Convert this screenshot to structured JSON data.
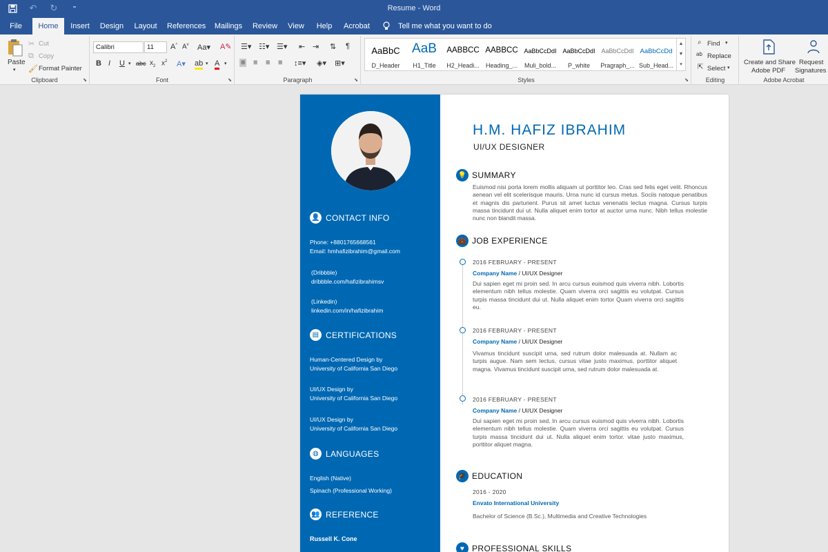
{
  "app": {
    "title": "Resume - Word"
  },
  "tabs": [
    {
      "label": "File"
    },
    {
      "label": "Home"
    },
    {
      "label": "Insert"
    },
    {
      "label": "Design"
    },
    {
      "label": "Layout"
    },
    {
      "label": "References"
    },
    {
      "label": "Mailings"
    },
    {
      "label": "Review"
    },
    {
      "label": "View"
    },
    {
      "label": "Help"
    },
    {
      "label": "Acrobat"
    }
  ],
  "tellme": "Tell me what you want to do",
  "ribbon": {
    "clipboard": {
      "paste": "Paste",
      "cut": "Cut",
      "copy": "Copy",
      "format_painter": "Format Painter",
      "label": "Clipboard"
    },
    "font": {
      "name": "Calibri",
      "size": "11",
      "label": "Font"
    },
    "paragraph": {
      "label": "Paragraph"
    },
    "styles": {
      "label": "Styles",
      "items": [
        {
          "sample": "AaBbC",
          "name": "D_Header"
        },
        {
          "sample": "AaB",
          "name": "H1_Title"
        },
        {
          "sample": "AABBCC",
          "name": "H2_Headi..."
        },
        {
          "sample": "AABBCC",
          "name": "Heading_..."
        },
        {
          "sample": "AaBbCcDdI",
          "name": "Muli_bold..."
        },
        {
          "sample": "AaBbCcDdI",
          "name": "P_white"
        },
        {
          "sample": "AaBbCcDdI",
          "name": "Pragraph_..."
        },
        {
          "sample": "AaBbCcDd",
          "name": "Sub_Head..."
        }
      ]
    },
    "editing": {
      "find": "Find",
      "replace": "Replace",
      "select": "Select",
      "label": "Editing"
    },
    "acrobat": {
      "create": "Create and Share",
      "create2": "Adobe PDF",
      "request": "Request",
      "request2": "Signatures",
      "label": "Adobe Acrobat"
    }
  },
  "resume": {
    "name": "H.M. HAFIZ IBRAHIM",
    "role": "UI/UX DESIGNER",
    "contact": {
      "heading": "CONTACT INFO",
      "phone": "Phone:  +8801765668561",
      "email": "Email: hmhafizibrahim@gmail.com",
      "dribbble_label": "(Dribbble)",
      "dribbble": "dribbble.com/hafizibrahimsv",
      "linkedin_label": "(Linkedin)",
      "linkedin": "linkedin.com/in/hafizibrahim"
    },
    "certifications": {
      "heading": "CERTIFICATIONS",
      "items": [
        {
          "title": "Human-Centered  Design  by",
          "org": "University  of  California  San  Diego"
        },
        {
          "title": "UI/UX  Design  by",
          "org": "University  of  California  San  Diego"
        },
        {
          "title": "UI/UX  Design  by",
          "org": "University  of  California  San  Diego"
        }
      ]
    },
    "languages": {
      "heading": "LANGUAGES",
      "items": [
        "English  (Native)",
        "Spinach  (Professional  Working)"
      ]
    },
    "reference": {
      "heading": "REFERENCE",
      "name": "Russell  K.  Cone"
    },
    "summary": {
      "heading": "SUMMARY",
      "text": "Euismod nisi porta lorem mollis aliquam ut porttitor leo. Cras sed felis eget velit. Rhoncus aenean vel elit scelerisque mauris. Urna nunc id cursus metus. Sociis natoque penatibus et magnis dis parturient. Purus sit amet luctus venenatis lectus magna. Cursus turpis massa tincidunt dui ut. Nulla aliquet enim tortor at auctor urna nunc. Nibh tellus molestie nunc non blandit massa."
    },
    "experience": {
      "heading": "JOB EXPERIENCE",
      "items": [
        {
          "date": "2016 FEBRUARY - PRESENT",
          "company": "Company Name",
          "title": "UI/UX Designer",
          "text": "Dui sapien eget mi proin sed. In arcu cursus euismod quis viverra nibh. Lobortis elementum nibh tellus molestie. Quam viverra orci sagittis eu volutpat. Cursus turpis massa tincidunt dui ut. Nulla aliquet enim tortor Quam viverra orci sagittis eu."
        },
        {
          "date": "2016 FEBRUARY - PRESENT",
          "company": "Company Name",
          "title": "UI/UX Designer",
          "text": "Vivamus tincidunt suscipit urna, sed rutrum dolor malesuada at. Nullam ac turpis augue. Nam sem lectus, cursus vitae justo maximus, porttitor aliquet magna. Vivamus tincidunt suscipit urna, sed rutrum dolor malesuada at."
        },
        {
          "date": "2016 FEBRUARY - PRESENT",
          "company": "Company Name",
          "title": "UI/UX Designer",
          "text": "Dui sapien eget mi proin sed. In arcu cursus euismod quis viverra nibh. Lobortis elementum nibh tellus molestie. Quam viverra orci sagittis eu volutpat. Cursus turpis massa tincidunt dui ut. Nulla aliquet enim tortor. vitae justo maximus, porttitor aliquet magna."
        }
      ]
    },
    "education": {
      "heading": "EDUCATION",
      "date": "2016 - 2020",
      "school": "Envato  International  University",
      "degree": "Bachelor of Science (B.Sc.), Multimedia and Creative Technologies"
    },
    "skills": {
      "heading": "PROFESSIONAL SKILLS"
    }
  },
  "colors": {
    "word_blue": "#2b579a",
    "resume_blue": "#0068b3"
  }
}
